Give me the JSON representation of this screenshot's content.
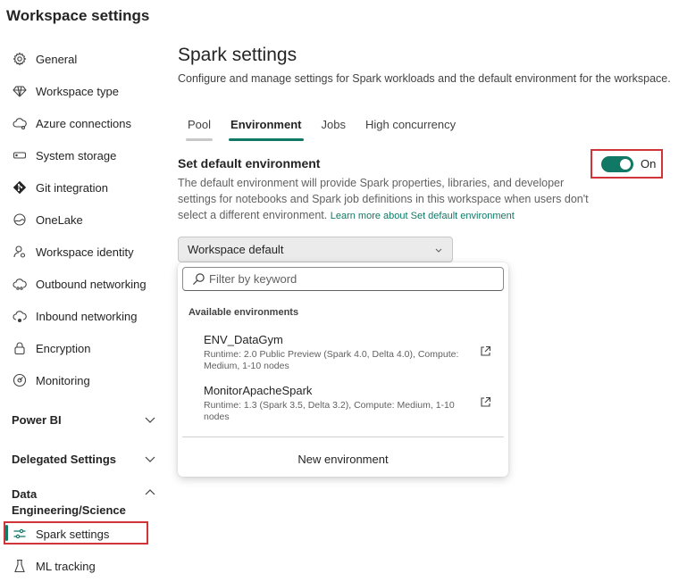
{
  "app_title": "Workspace settings",
  "sidebar": {
    "items": [
      {
        "label": "General",
        "icon": "gear-icon"
      },
      {
        "label": "Workspace type",
        "icon": "diamond-icon"
      },
      {
        "label": "Azure connections",
        "icon": "cloud-link-icon"
      },
      {
        "label": "System storage",
        "icon": "storage-icon"
      },
      {
        "label": "Git integration",
        "icon": "git-icon"
      },
      {
        "label": "OneLake",
        "icon": "onelake-icon"
      },
      {
        "label": "Workspace identity",
        "icon": "identity-icon"
      },
      {
        "label": "Outbound networking",
        "icon": "cloud-outbound-icon"
      },
      {
        "label": "Inbound networking",
        "icon": "cloud-inbound-icon"
      },
      {
        "label": "Encryption",
        "icon": "lock-icon"
      },
      {
        "label": "Monitoring",
        "icon": "monitoring-icon"
      }
    ],
    "sections": [
      {
        "label": "Power BI",
        "expanded": false
      },
      {
        "label": "Delegated Settings",
        "expanded": false
      },
      {
        "label_line1": "Data",
        "label_line2": "Engineering/Science",
        "expanded": true
      }
    ],
    "sub_items": [
      {
        "label": "Spark settings",
        "icon": "sliders-icon",
        "selected": true
      },
      {
        "label": "ML tracking",
        "icon": "flask-icon"
      }
    ]
  },
  "main": {
    "title": "Spark settings",
    "subtitle": "Configure and manage settings for Spark workloads and the default environment for the workspace.",
    "tabs": [
      {
        "label": "Pool"
      },
      {
        "label": "Environment",
        "active": true
      },
      {
        "label": "Jobs"
      },
      {
        "label": "High concurrency"
      }
    ],
    "section_title": "Set default environment",
    "section_desc": "The default environment will provide Spark properties, libraries, and developer settings for notebooks and Spark job definitions in this workspace when users don't select a different environment.",
    "learn_more": "Learn more about Set default environment",
    "toggle": {
      "label": "On",
      "on": true
    },
    "dropdown": {
      "value": "Workspace default"
    }
  },
  "popup": {
    "filter_placeholder": "Filter by keyword",
    "available_label": "Available environments",
    "environments": [
      {
        "name": "ENV_DataGym",
        "meta": "Runtime: 2.0 Public Preview (Spark 4.0, Delta 4.0), Compute: Medium, 1-10 nodes"
      },
      {
        "name": "MonitorApacheSpark",
        "meta": "Runtime: 1.3 (Spark 3.5, Delta 3.2), Compute: Medium, 1-10 nodes"
      }
    ],
    "new_environment": "New environment"
  },
  "colors": {
    "accent": "#117865",
    "highlight_border": "#d13438"
  }
}
